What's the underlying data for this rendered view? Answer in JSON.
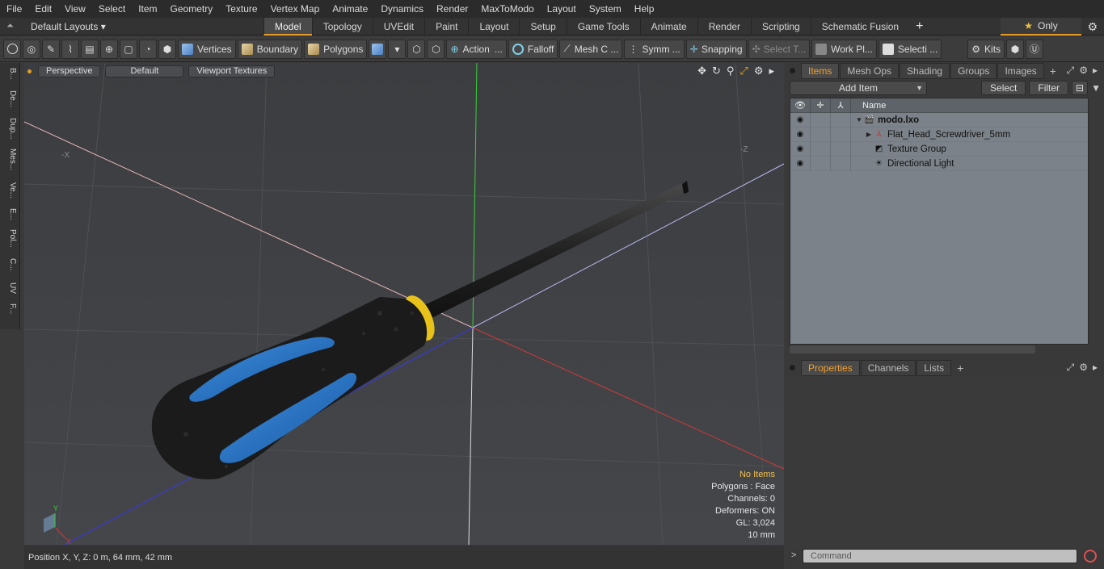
{
  "menu": [
    "File",
    "Edit",
    "View",
    "Select",
    "Item",
    "Geometry",
    "Texture",
    "Vertex Map",
    "Animate",
    "Dynamics",
    "Render",
    "MaxToModo",
    "Layout",
    "System",
    "Help"
  ],
  "layouts": {
    "label": "Default Layouts ▾"
  },
  "tabs": [
    "Model",
    "Topology",
    "UVEdit",
    "Paint",
    "Layout",
    "Setup",
    "Game Tools",
    "Animate",
    "Render",
    "Scripting",
    "Schematic Fusion"
  ],
  "tab_add": "+",
  "only_label": "Only",
  "toolbar": {
    "vertices": "Vertices",
    "boundary": "Boundary",
    "polygons": "Polygons",
    "action": "Action",
    "falloff": "Falloff",
    "mesh": "Mesh C ...",
    "symm": "Symm ...",
    "snapping": "Snapping",
    "select_t": "Select T...",
    "work_pl": "Work Pl...",
    "selecti": "Selecti ...",
    "kits": "Kits"
  },
  "left_tabs": [
    "B...",
    "De...",
    "Dup...",
    "Mes...",
    "Ve...",
    "E...",
    "Pol...",
    "C...",
    "UV",
    "F..."
  ],
  "viewport": {
    "mode": "Perspective",
    "shading": "Default",
    "textures": "Viewport Textures",
    "axis_x": "-X",
    "axis_z": "-Z",
    "gizmo_y": "Y",
    "gizmo_x": "X",
    "stats": {
      "items": "No Items",
      "polygons": "Polygons : Face",
      "channels": "Channels: 0",
      "deformers": "Deformers: ON",
      "gl": "GL: 3,024",
      "size": "10 mm"
    }
  },
  "status": {
    "position": "Position X, Y, Z:   0 m, 64 mm, 42 mm"
  },
  "panel": {
    "tabs": [
      "Items",
      "Mesh Ops",
      "Shading",
      "Groups",
      "Images"
    ],
    "add_item": "Add Item",
    "select": "Select",
    "filter": "Filter",
    "col_name": "Name",
    "items": [
      {
        "name": "modo.lxo",
        "bold": true
      },
      {
        "name": "Flat_Head_Screwdriver_5mm",
        "bold": false
      },
      {
        "name": "Texture Group",
        "bold": false
      },
      {
        "name": "Directional Light",
        "bold": false
      }
    ],
    "prop_tabs": [
      "Properties",
      "Channels",
      "Lists"
    ],
    "command_placeholder": "Command"
  },
  "colors": {
    "accent": "#e59a2c",
    "handle_blue": "#1d6fc4",
    "handle_black": "#1b1b1b",
    "ferrule": "#e8c21a",
    "axis_x": "#d23a3a",
    "axis_y": "#3ad23a",
    "axis_z": "#3a3ad2"
  }
}
